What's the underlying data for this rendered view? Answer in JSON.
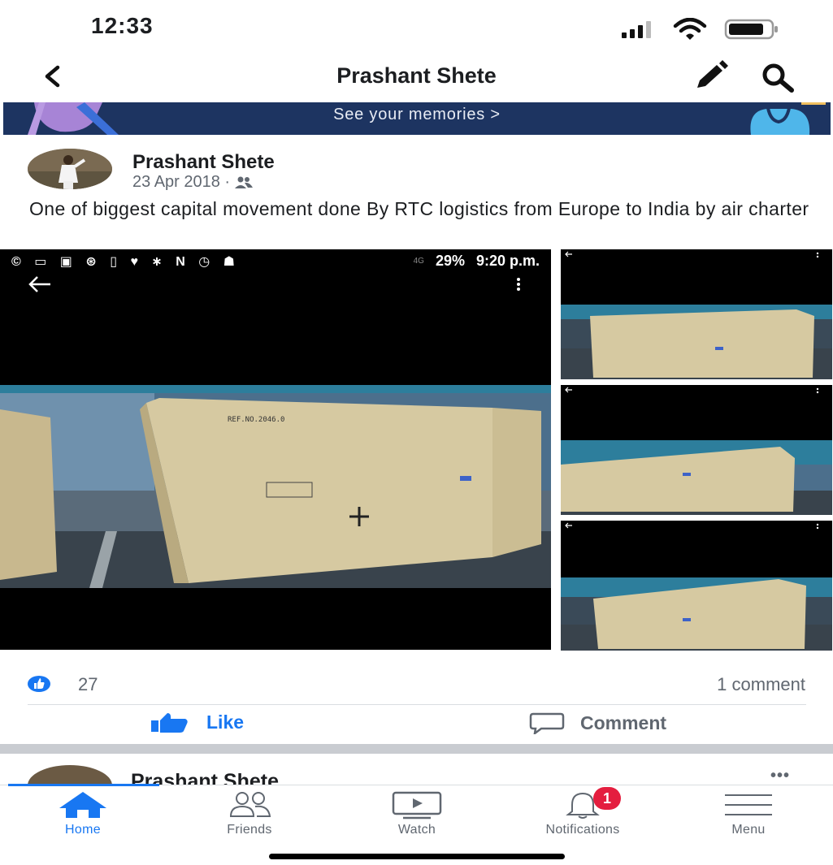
{
  "status_bar": {
    "time": "12:33"
  },
  "header": {
    "title": "Prashant Shete"
  },
  "memories": {
    "label": "See your memories >"
  },
  "post": {
    "author": "Prashant Shete",
    "date": "23 Apr 2018 ·",
    "audience_icon": "friends-icon",
    "text": "One of biggest capital movement done By RTC logistics from Europe to India by air charter",
    "photo_status": {
      "icons": "© ▭ ▣ ⊛ ▯ ♥ ∗ N ◷ ☗",
      "network": "4G",
      "battery": "29%",
      "time": "9:20 p.m."
    },
    "likes": "27",
    "comments": "1 comment",
    "actions": {
      "like": "Like",
      "comment": "Comment"
    }
  },
  "next_post": {
    "author": "Prashant Shete",
    "more": "•••"
  },
  "tabs": [
    {
      "label": "Home",
      "icon": "home-icon",
      "active": true
    },
    {
      "label": "Friends",
      "icon": "friends-icon",
      "active": false
    },
    {
      "label": "Watch",
      "icon": "watch-icon",
      "active": false
    },
    {
      "label": "Notifications",
      "icon": "bell-icon",
      "badge": "1",
      "active": false
    },
    {
      "label": "Menu",
      "icon": "menu-icon",
      "active": false
    }
  ],
  "colors": {
    "accent": "#1877f2",
    "banner": "#1d3461",
    "badge": "#e41e3f",
    "muted": "#606770"
  }
}
